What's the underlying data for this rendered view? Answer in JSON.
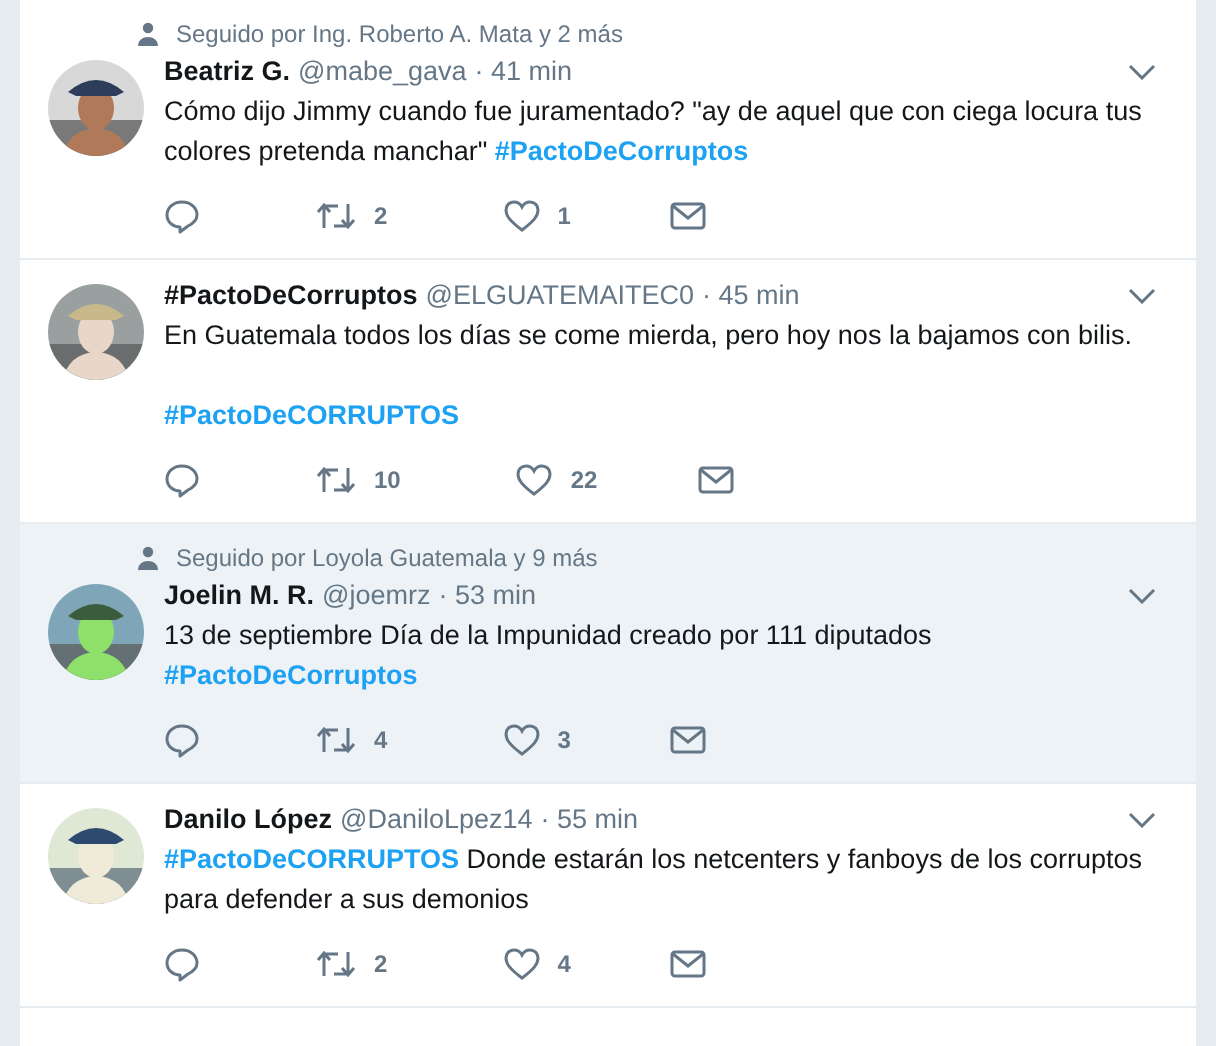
{
  "tweets": [
    {
      "context": "Seguido por Ing. Roberto A. Mata y 2 más",
      "highlighted": false,
      "name": "Beatriz G.",
      "handle": "@mabe_gava",
      "time": "· 41 min",
      "paragraphs": [
        [
          {
            "kind": "plain",
            "text": "Cómo dijo Jimmy cuando fue juramentado? \"ay de aquel que con ciega locura tus colores pretenda manchar\" "
          },
          {
            "kind": "hashtag",
            "text": "#PactoDeCorruptos"
          }
        ]
      ],
      "retweets": "2",
      "likes": "1"
    },
    {
      "highlighted": false,
      "name": "#PactoDeCorruptos",
      "handle": "@ELGUATEMAITEC0",
      "time": "· 45 min",
      "paragraphs": [
        [
          {
            "kind": "plain",
            "text": "En Guatemala todos los días se come mierda, pero hoy nos la bajamos con bilis."
          }
        ],
        [
          {
            "kind": "hashtag",
            "text": "#PactoDeCORRUPTOS"
          }
        ]
      ],
      "retweets": "10",
      "likes": "22"
    },
    {
      "context": "Seguido por Loyola Guatemala y 9 más",
      "highlighted": true,
      "name": "Joelin M. R.",
      "handle": "@joemrz",
      "time": "· 53 min",
      "paragraphs": [
        [
          {
            "kind": "plain",
            "text": "13 de septiembre Día de la Impunidad creado por 111 diputados "
          },
          {
            "kind": "hashtag",
            "text": "#PactoDeCorruptos"
          }
        ]
      ],
      "retweets": "4",
      "likes": "3"
    },
    {
      "highlighted": false,
      "name": "Danilo López",
      "handle": "@DaniloLpez14",
      "time": "· 55 min",
      "paragraphs": [
        [
          {
            "kind": "hashtag",
            "text": "#PactoDeCORRUPTOS"
          },
          {
            "kind": "plain",
            "text": " Donde estarán los netcenters y fanboys de los corruptos para defender a sus demonios"
          }
        ]
      ],
      "retweets": "2",
      "likes": "4"
    }
  ]
}
